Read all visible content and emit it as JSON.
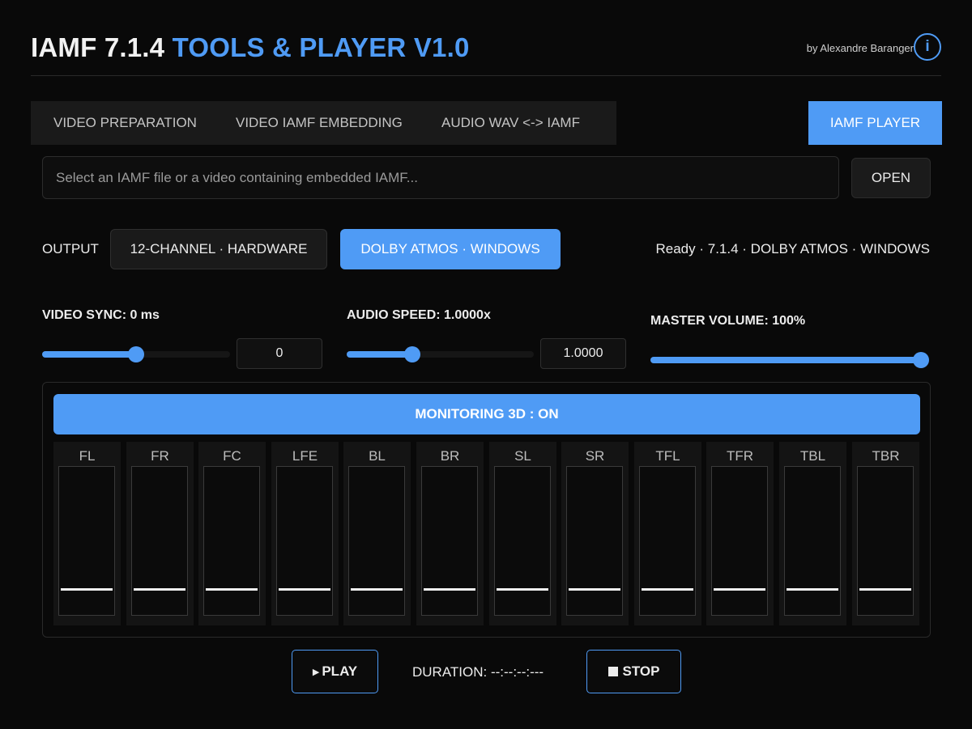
{
  "header": {
    "title_white": "IAMF 7.1.4",
    "title_blue": "TOOLS & PLAYER V1.0",
    "author": "by Alexandre Baranger",
    "info_icon": "i"
  },
  "tabs": [
    {
      "label": "VIDEO PREPARATION",
      "active": false
    },
    {
      "label": "VIDEO IAMF EMBEDDING",
      "active": false
    },
    {
      "label": "AUDIO WAV <-> IAMF",
      "active": false
    },
    {
      "label": "IAMF PLAYER",
      "active": true
    }
  ],
  "file": {
    "placeholder": "Select an IAMF file or a video containing embedded IAMF...",
    "open_label": "OPEN"
  },
  "output": {
    "label": "OUTPUT",
    "options": [
      {
        "label": "12-CHANNEL · HARDWARE",
        "selected": false
      },
      {
        "label": "DOLBY ATMOS · WINDOWS",
        "selected": true
      }
    ],
    "status": "Ready · 7.1.4 · DOLBY ATMOS · WINDOWS"
  },
  "controls": {
    "video_sync": {
      "label": "VIDEO SYNC: 0 ms",
      "value": "0",
      "fraction": 0.5
    },
    "audio_speed": {
      "label": "AUDIO SPEED: 1.0000x",
      "value": "1.0000",
      "fraction": 0.35
    },
    "master_volume": {
      "label": "MASTER VOLUME: 100%",
      "fraction": 1.0
    }
  },
  "monitor": {
    "toggle_label": "MONITORING 3D : ON",
    "channels": [
      "FL",
      "FR",
      "FC",
      "LFE",
      "BL",
      "BR",
      "SL",
      "SR",
      "TFL",
      "TFR",
      "TBL",
      "TBR"
    ],
    "level_fraction": 0.18
  },
  "transport": {
    "play_icon": "▶",
    "play_label": "PLAY",
    "duration": "DURATION: --:--:--:---",
    "stop_label": "STOP"
  },
  "colors": {
    "accent": "#4f9bf5",
    "background": "#090909"
  }
}
